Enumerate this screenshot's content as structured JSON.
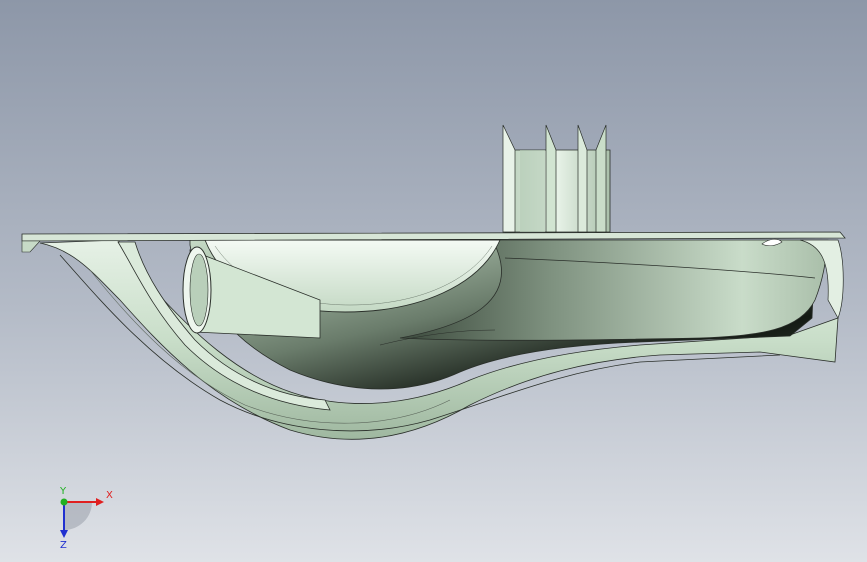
{
  "triad": {
    "x_label": "X",
    "y_label": "Y",
    "z_label": "Z",
    "x_color": "#e02020",
    "y_color": "#20b020",
    "z_color": "#2030d0"
  },
  "model": {
    "surface_color": "#cfe3cf",
    "shadow_color": "#1c241c",
    "edge_color": "#2a2f2a"
  }
}
